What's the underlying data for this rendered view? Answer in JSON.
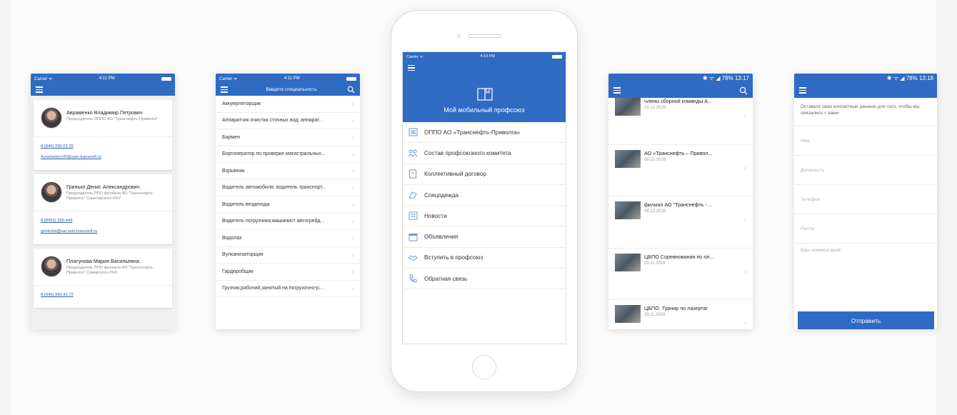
{
  "colors": {
    "accent": "#2f6bc3",
    "link": "#2a5db0"
  },
  "contacts_screen": {
    "status": {
      "carrier": "Carrier ᯤ",
      "time": "4:11 PM"
    },
    "contacts": [
      {
        "name": "Авраменко Владимир Петрович",
        "role": "Председатель ОППО АО \"Транснефть-Приволга\"",
        "phone": "8 (846) 250 02 29",
        "email": "AvramenkoVP@sam.transneft.ru"
      },
      {
        "name": "Гринько Денис Александрович",
        "role": "Председатель ППО филиала АО \"Транснефть- Приволга\" Саратовского РНУ",
        "phone": "8 (8452) 356-449",
        "email": "grinkoda@sar.sam.transneft.ru"
      },
      {
        "name": "Платунова Мария Васильевна",
        "role": "Председатель ППО филиала АО \"Транснефть- Приволга\" Самарского РНУ",
        "phone": "8 (846) 999 41 72",
        "email": ""
      }
    ]
  },
  "specialty_screen": {
    "status": {
      "carrier": "Carrier ᯤ",
      "time": "4:11 PM"
    },
    "nav_title": "Введите специальность",
    "items": [
      "Аккумуляторщик",
      "Аппаратчик очистки сточных вод; аппарат...",
      "Бармен",
      "Бортоператор по проверке магистральных...",
      "Взрывник",
      "Водитель автомобиля; водитель транспорт...",
      "Водитель вездехода",
      "Водитель погрузчика;машинист автогрейд...",
      "Водолаз",
      "Вулканизаторщик",
      "Гардеробщик",
      "Грузчик;рабочий,занятый на погрузочно-р..."
    ]
  },
  "main_screen": {
    "status": {
      "carrier": "Carrier ᯤ",
      "time": "4:10 PM"
    },
    "app_title": "Мой мобильный профсоюз",
    "menu": [
      {
        "label": "ОППО АО «Транснефть-Приволга»",
        "icon": "document-list-icon"
      },
      {
        "label": "Состав профсоюзного комитета",
        "icon": "people-icon"
      },
      {
        "label": "Коллективный договор",
        "icon": "contract-icon"
      },
      {
        "label": "Спецодежда",
        "icon": "clothing-icon"
      },
      {
        "label": "Новости",
        "icon": "news-icon"
      },
      {
        "label": "Объявления",
        "icon": "calendar-icon"
      },
      {
        "label": "Вступить в профсоюз",
        "icon": "handshake-icon"
      },
      {
        "label": "Обратная связь",
        "icon": "phone-icon"
      }
    ]
  },
  "news_screen": {
    "status": {
      "icons": "✱ ᯤ ◢ 78%",
      "time": "13:17"
    },
    "items": [
      {
        "title": "члены сборной команды А...",
        "date": "19.12.2016"
      },
      {
        "title": "АО «Транснефть – Привол...",
        "date": "09.12.2016"
      },
      {
        "title": "филиал АО \"Транснефть - ...",
        "date": "08.12.2016"
      },
      {
        "title": "ЦБПО Соревнования по пл...",
        "date": "29.11.2016"
      },
      {
        "title": "ЦБПО. Турнир по лазертаг",
        "date": "29.11.2016"
      }
    ]
  },
  "feedback_screen": {
    "status": {
      "icons": "✱ ᯤ ◢ 78%",
      "time": "13:18"
    },
    "intro": "Оставьте свои контактные данные для того, чтобы мы связались с вами",
    "placeholders": {
      "name": "Имя",
      "position": "Должность",
      "phone": "Телефон",
      "mail": "Почта",
      "comment": "Ваш комментарий"
    },
    "submit_label": "Отправить"
  }
}
